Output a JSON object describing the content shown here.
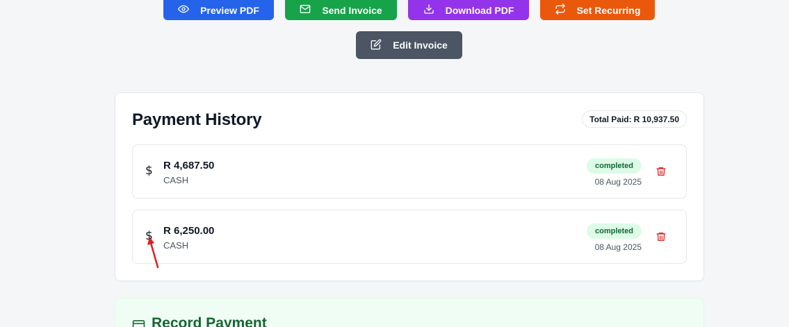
{
  "actions": {
    "preview_label": "Preview PDF",
    "send_label": "Send Invoice",
    "download_label": "Download PDF",
    "recurring_label": "Set Recurring",
    "edit_label": "Edit Invoice"
  },
  "payment_history": {
    "title": "Payment History",
    "total_label": "Total Paid:",
    "total_value": "R 10,937.50",
    "payments": [
      {
        "icon": "$",
        "amount": "R 4,687.50",
        "method": "CASH",
        "status": "completed",
        "date": "08 Aug 2025"
      },
      {
        "icon": "$",
        "amount": "R 6,250.00",
        "method": "CASH",
        "status": "completed",
        "date": "08 Aug 2025"
      }
    ]
  },
  "record_payment": {
    "title": "Record Payment"
  },
  "colors": {
    "preview": "#2563eb",
    "send": "#16a34a",
    "download": "#9333ea",
    "recurring": "#ea580c",
    "edit": "#4b5563",
    "status_bg": "#dcfce7",
    "status_text": "#166534",
    "delete": "#dc2626",
    "annotation": "#e11d1d"
  },
  "icons": {
    "preview": "eye-icon",
    "send": "mail-icon",
    "download": "download-icon",
    "recurring": "repeat-icon",
    "edit": "edit-icon",
    "delete": "trash-icon",
    "record": "credit-card-icon"
  }
}
